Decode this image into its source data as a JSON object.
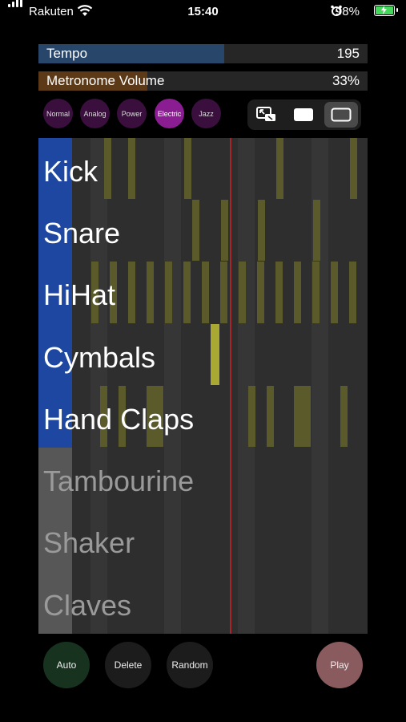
{
  "status": {
    "carrier": "Rakuten",
    "time": "15:40",
    "battery": "98%"
  },
  "tempo": {
    "label": "Tempo",
    "value": "195",
    "fill_fraction": 0.56
  },
  "metronome": {
    "label": "Metronome Volume",
    "value": "33%",
    "fill_fraction": 0.33
  },
  "kits": [
    {
      "label": "Normal",
      "selected": false
    },
    {
      "label": "Analog",
      "selected": false
    },
    {
      "label": "Power",
      "selected": false
    },
    {
      "label": "Electric",
      "selected": true
    },
    {
      "label": "Jazz",
      "selected": false
    }
  ],
  "view_modes": [
    "pip-icon",
    "filled-rect-icon",
    "outline-rect-icon"
  ],
  "tracks": [
    {
      "name": "Kick",
      "active": true
    },
    {
      "name": "Snare",
      "active": true
    },
    {
      "name": "HiHat",
      "active": true
    },
    {
      "name": "Cymbals",
      "active": true
    },
    {
      "name": "Hand Claps",
      "active": true
    },
    {
      "name": "Tambourine",
      "active": false
    },
    {
      "name": "Shaker",
      "active": false
    },
    {
      "name": "Claves",
      "active": false
    }
  ],
  "buttons": {
    "auto": "Auto",
    "delete": "Delete",
    "random": "Random",
    "play": "Play"
  },
  "colors": {
    "accent_active": "#1d47a0",
    "kit_selected": "#8b1d92",
    "note": "#5a5a2a",
    "note_current": "#a8a833",
    "playhead": "#a8262a",
    "auto_btn": "#173320",
    "play_btn": "#8a5b5e"
  }
}
